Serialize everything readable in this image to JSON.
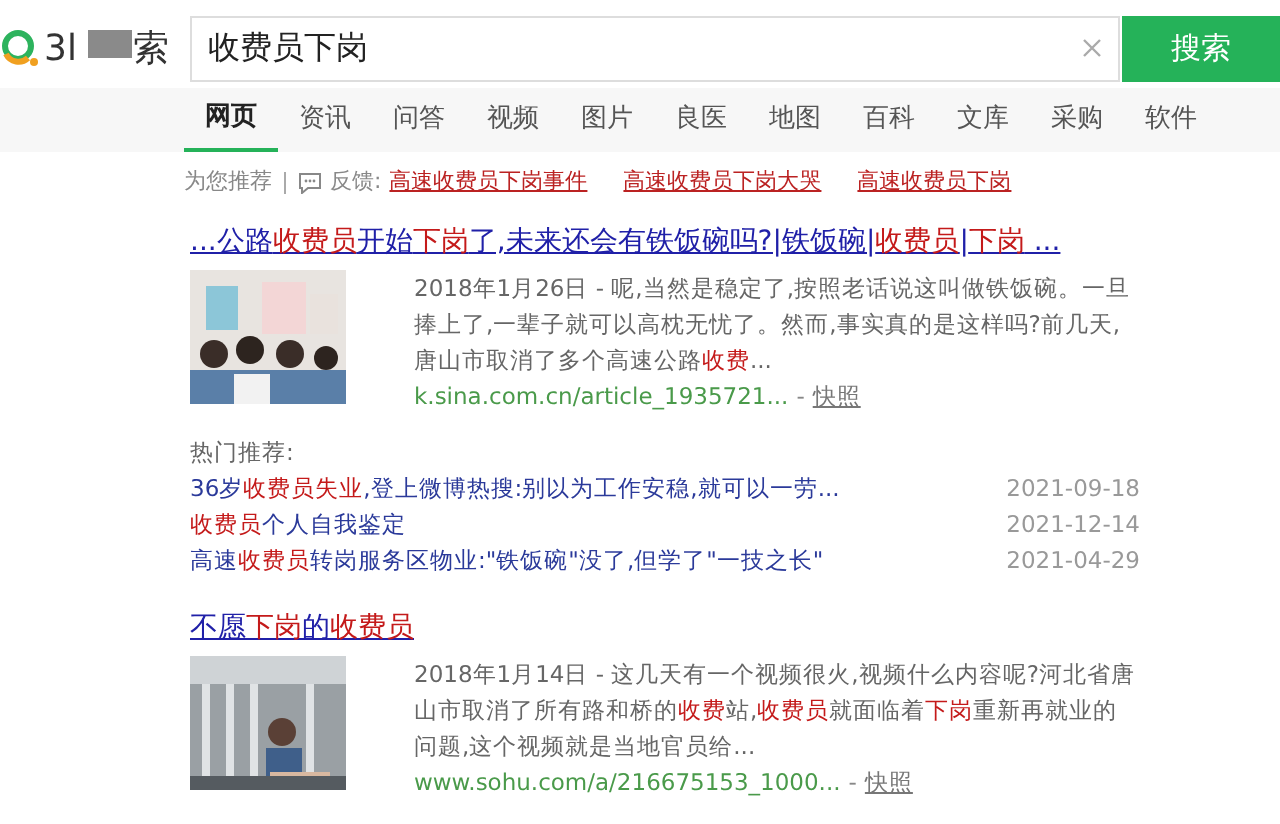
{
  "logo": {
    "left": "3l",
    "right": "索"
  },
  "search": {
    "value": "收费员下岗",
    "button": "搜索"
  },
  "tabs": [
    {
      "label": "网页",
      "selected": true
    },
    {
      "label": "资讯",
      "selected": false
    },
    {
      "label": "问答",
      "selected": false
    },
    {
      "label": "视频",
      "selected": false
    },
    {
      "label": "图片",
      "selected": false
    },
    {
      "label": "良医",
      "selected": false
    },
    {
      "label": "地图",
      "selected": false
    },
    {
      "label": "百科",
      "selected": false
    },
    {
      "label": "文库",
      "selected": false
    },
    {
      "label": "采购",
      "selected": false
    },
    {
      "label": "软件",
      "selected": false
    }
  ],
  "recommend": {
    "label": "为您推荐",
    "feedback": "反馈:",
    "links": [
      "高速收费员下岗事件",
      "高速收费员下岗大哭",
      "高速收费员下岗"
    ]
  },
  "results": [
    {
      "title": [
        {
          "t": "...公路",
          "hl": false
        },
        {
          "t": "收费员",
          "hl": true
        },
        {
          "t": "开始",
          "hl": false
        },
        {
          "t": "下岗",
          "hl": true
        },
        {
          "t": "了,未来还会有铁饭碗吗?|铁饭碗|",
          "hl": false
        },
        {
          "t": "收费员",
          "hl": true
        },
        {
          "t": "|",
          "hl": false
        },
        {
          "t": "下岗",
          "hl": true
        },
        {
          "t": " ...",
          "hl": false
        }
      ],
      "thumb": {
        "kind": "picture"
      },
      "snippet": [
        {
          "t": "2018年1月26日 - 呢,当然是稳定了,按照老话说这叫做铁饭碗。一旦捧上了,一辈子就可以高枕无忧了。然而,事实真的是这样吗?前几天,唐山市取消了多个高速公路",
          "hl": false
        },
        {
          "t": "收费",
          "hl": true
        },
        {
          "t": "...",
          "hl": false
        }
      ],
      "url": "k.sina.com.cn/article_1935721...",
      "separator": "-",
      "snapshot": "快照",
      "hot": {
        "label": "热门推荐:",
        "items": [
          {
            "title": [
              {
                "t": "36岁",
                "hl": false
              },
              {
                "t": "收费员失业",
                "hl": true
              },
              {
                "t": ",登上微博热搜:别以为工作安稳,就可以一劳...",
                "hl": false
              }
            ],
            "date": "2021-09-18"
          },
          {
            "title": [
              {
                "t": "收费员",
                "hl": true
              },
              {
                "t": "个人自我鉴定",
                "hl": false
              }
            ],
            "date": "2021-12-14"
          },
          {
            "title": [
              {
                "t": "高速",
                "hl": false
              },
              {
                "t": "收费员",
                "hl": true
              },
              {
                "t": "转岗服务区物业:\"铁饭碗\"没了,但学了\"一技之长\"",
                "hl": false
              }
            ],
            "date": "2021-04-29"
          }
        ]
      }
    },
    {
      "title": [
        {
          "t": "不愿",
          "hl": false
        },
        {
          "t": "下岗",
          "hl": true
        },
        {
          "t": "的",
          "hl": false
        },
        {
          "t": "收费员",
          "hl": true
        }
      ],
      "thumb": {
        "kind": "picture"
      },
      "snippet": [
        {
          "t": "2018年1月14日 - 这几天有一个视频很火,视频什么内容呢?河北省唐山市取消了所有路和桥的",
          "hl": false
        },
        {
          "t": "收费",
          "hl": true
        },
        {
          "t": "站,",
          "hl": false
        },
        {
          "t": "收费员",
          "hl": true
        },
        {
          "t": "就面临着",
          "hl": false
        },
        {
          "t": "下岗",
          "hl": true
        },
        {
          "t": "重新再就业的问题,这个视频就是当地官员给...",
          "hl": false
        }
      ],
      "url": "www.sohu.com/a/216675153_1000...",
      "separator": "-",
      "snapshot": "快照"
    }
  ]
}
